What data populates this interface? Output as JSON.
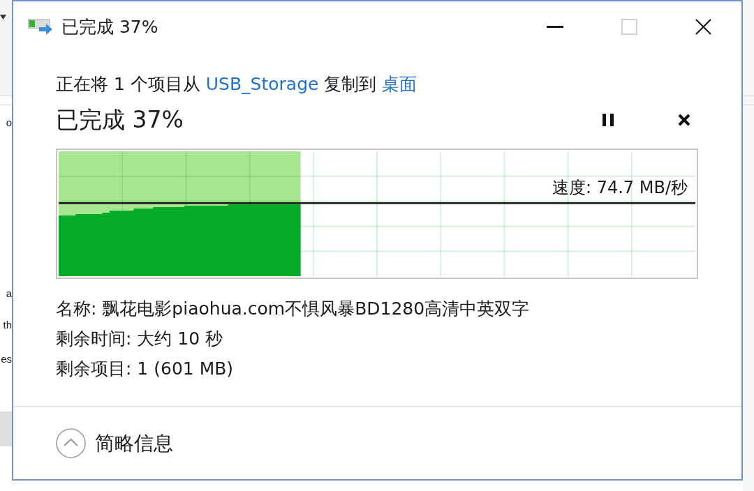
{
  "background_window": {
    "texts": [
      "o",
      "a",
      "th",
      "es"
    ]
  },
  "window": {
    "title": "已完成 37%",
    "buttons": [
      {
        "kind": "minimize",
        "disabled": false
      },
      {
        "kind": "maximize",
        "disabled": true
      },
      {
        "kind": "close",
        "disabled": false
      }
    ]
  },
  "transfer": {
    "description": [
      {
        "kind": "text",
        "text": "正在将 1 个项目从 "
      },
      {
        "kind": "link",
        "text": "USB_Storage"
      },
      {
        "kind": "text",
        "text": " 复制到 "
      },
      {
        "kind": "link",
        "text": "桌面"
      }
    ],
    "status": "已完成 37%",
    "controls": [
      {
        "kind": "pause"
      },
      {
        "kind": "cancel"
      }
    ],
    "progress": {
      "level": 0.38,
      "speed": "速度: 74.7 MB/秒"
    },
    "details": [
      "名称: 飘花电影piaohua.com不惧风暴BD1280高清中英双字",
      "剩余时间: 大约 10 秒",
      "剩余项目: 1 (601 MB)"
    ]
  },
  "footer": {
    "details_toggle": {
      "label": "简略信息",
      "expanded": true
    }
  }
}
